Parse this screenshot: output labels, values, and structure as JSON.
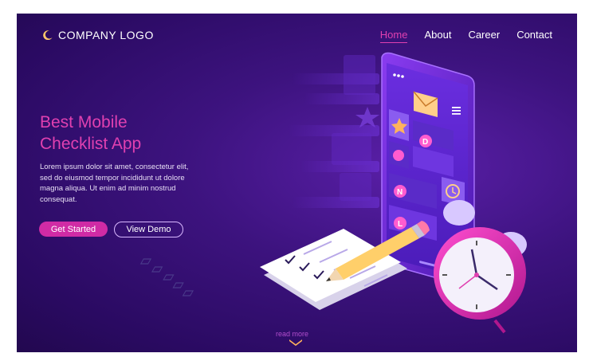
{
  "header": {
    "logo_text": "COMPANY LOGO",
    "nav": [
      {
        "label": "Home",
        "active": true
      },
      {
        "label": "About",
        "active": false
      },
      {
        "label": "Career",
        "active": false
      },
      {
        "label": "Contact",
        "active": false
      }
    ]
  },
  "hero": {
    "title_line1": "Best Mobile",
    "title_line2": "Checklist App",
    "body": "Lorem ipsum dolor sit amet, consectetur elit, sed do eiusmod tempor incididunt ut dolore magna aliqua. Ut enim ad minim nostrud consequat.",
    "primary_button": "Get Started",
    "secondary_button": "View Demo"
  },
  "footer": {
    "read_more": "read more"
  },
  "colors": {
    "accent": "#d02ba5",
    "background": "#3d137f",
    "nav_active": "#e040b0"
  },
  "illustration": {
    "phone_icons": [
      "mail-icon",
      "star-icon",
      "letter-d-icon",
      "person-icon",
      "letter-n-icon",
      "clock-icon",
      "letter-l-icon"
    ],
    "objects": [
      "smartphone",
      "checklist-paper",
      "pencil",
      "alarm-clock"
    ]
  }
}
